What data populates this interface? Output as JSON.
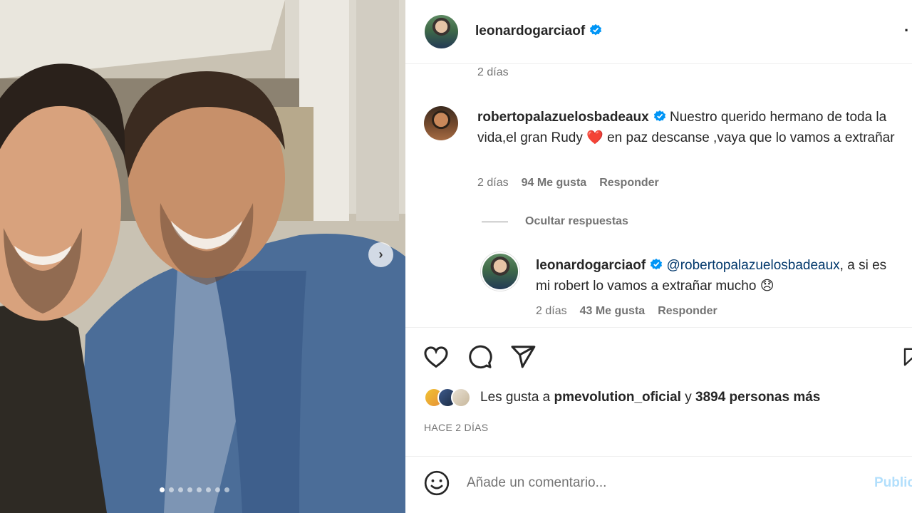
{
  "header": {
    "username": "leonardogarciaof",
    "more_icon": "ellipsis-icon"
  },
  "comments": {
    "top_timestamp": "2 días",
    "items": [
      {
        "username": "robertopalazuelosbadeaux",
        "text_before_heart": "Nuestro querido hermano de toda la vida,el gran Rudy ",
        "heart": "❤️",
        "text_after_heart": " en paz descanse ,vaya que lo vamos a extrañar",
        "time": "2 días",
        "likes": "94 Me gusta",
        "reply_label": "Responder"
      }
    ],
    "hide_replies_label": "Ocultar respuestas",
    "replies": [
      {
        "username": "leonardogarciaof",
        "mention": "@robertopalazuelosbadeaux",
        "text": ", a si es mi robert lo vamos a extrañar mucho ",
        "emoji": "😞",
        "time": "2 días",
        "likes": "43 Me gusta",
        "reply_label": "Responder"
      }
    ]
  },
  "actions": {
    "like_icon": "heart-icon",
    "comment_icon": "comment-icon",
    "share_icon": "send-icon",
    "save_icon": "bookmark-icon"
  },
  "likes": {
    "prefix": "Les gusta a ",
    "user": "pmevolution_oficial",
    "middle": " y ",
    "count": "3894 personas más"
  },
  "posted_ago": "HACE 2 DÍAS",
  "add_comment": {
    "placeholder": "Añade un comentario...",
    "post_label": "Publicar"
  },
  "carousel": {
    "slides": 8,
    "active_index": 0
  },
  "colors": {
    "verified": "#0095f6",
    "heart": "#e0245e",
    "mention": "#00376b",
    "post_disabled": "#b2dffc"
  }
}
